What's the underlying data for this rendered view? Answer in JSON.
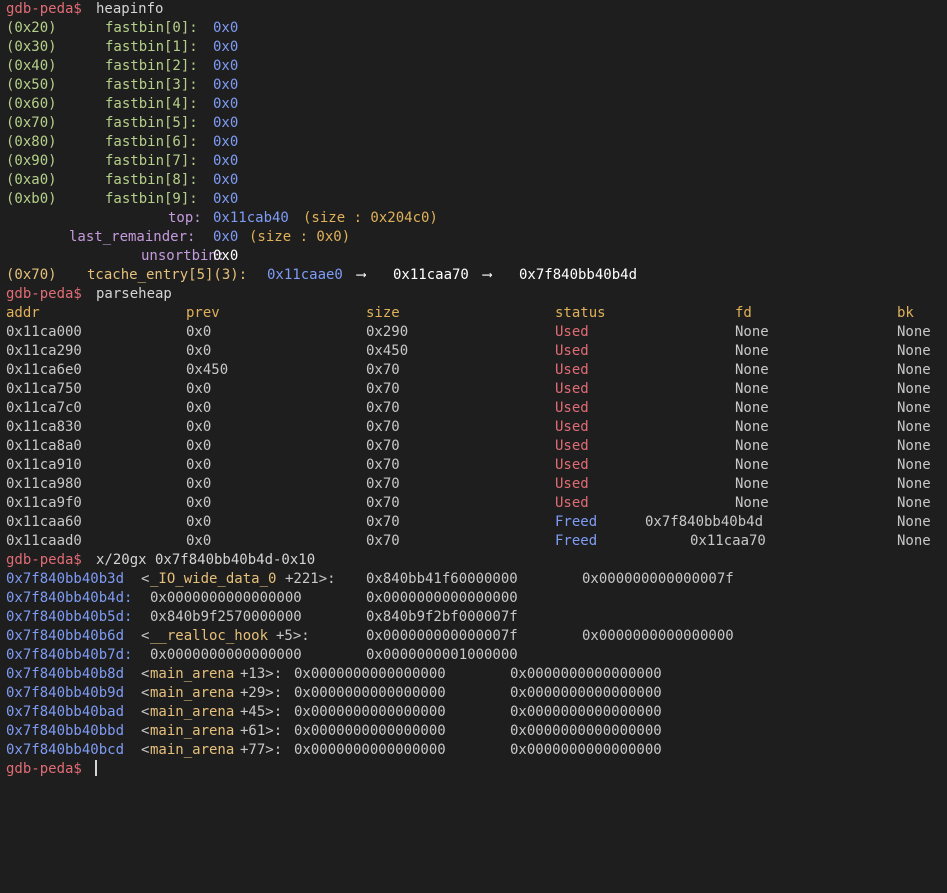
{
  "prompt": "gdb-peda$",
  "commands": {
    "heapinfo": "heapinfo",
    "parseheap": "parseheap",
    "examine": "x/20gx 0x7f840bb40b4d-0x10"
  },
  "heapinfo": {
    "fastbins": [
      {
        "size": "(0x20)",
        "name": "fastbin[0]:",
        "value": "0x0"
      },
      {
        "size": "(0x30)",
        "name": "fastbin[1]:",
        "value": "0x0"
      },
      {
        "size": "(0x40)",
        "name": "fastbin[2]:",
        "value": "0x0"
      },
      {
        "size": "(0x50)",
        "name": "fastbin[3]:",
        "value": "0x0"
      },
      {
        "size": "(0x60)",
        "name": "fastbin[4]:",
        "value": "0x0"
      },
      {
        "size": "(0x70)",
        "name": "fastbin[5]:",
        "value": "0x0"
      },
      {
        "size": "(0x80)",
        "name": "fastbin[6]:",
        "value": "0x0"
      },
      {
        "size": "(0x90)",
        "name": "fastbin[7]:",
        "value": "0x0"
      },
      {
        "size": "(0xa0)",
        "name": "fastbin[8]:",
        "value": "0x0"
      },
      {
        "size": "(0xb0)",
        "name": "fastbin[9]:",
        "value": "0x0"
      }
    ],
    "top": {
      "label": "top:",
      "addr": "0x11cab40",
      "size": "(size : 0x204c0)"
    },
    "last_remainder": {
      "label": "last_remainder:",
      "addr": "0x0",
      "size": "(size : 0x0)"
    },
    "unsortbin": {
      "label": "unsortbin:",
      "value": "0x0"
    },
    "tcache": {
      "size": "(0x70)",
      "label": "tcache_entry[5](3):",
      "first": "0x11caae0",
      "arrow1": "⟶",
      "second": "0x11caa70",
      "arrow2": "⟶",
      "third": "0x7f840bb40b4d"
    }
  },
  "parseheap": {
    "headers": [
      "addr",
      "prev",
      "size",
      "status",
      "fd",
      "bk"
    ],
    "rows": [
      {
        "addr": "0x11ca000",
        "prev": "0x0",
        "size": "0x290",
        "status": "Used",
        "fd": "None",
        "bk": "None"
      },
      {
        "addr": "0x11ca290",
        "prev": "0x0",
        "size": "0x450",
        "status": "Used",
        "fd": "None",
        "bk": "None"
      },
      {
        "addr": "0x11ca6e0",
        "prev": "0x450",
        "size": "0x70",
        "status": "Used",
        "fd": "None",
        "bk": "None"
      },
      {
        "addr": "0x11ca750",
        "prev": "0x0",
        "size": "0x70",
        "status": "Used",
        "fd": "None",
        "bk": "None"
      },
      {
        "addr": "0x11ca7c0",
        "prev": "0x0",
        "size": "0x70",
        "status": "Used",
        "fd": "None",
        "bk": "None"
      },
      {
        "addr": "0x11ca830",
        "prev": "0x0",
        "size": "0x70",
        "status": "Used",
        "fd": "None",
        "bk": "None"
      },
      {
        "addr": "0x11ca8a0",
        "prev": "0x0",
        "size": "0x70",
        "status": "Used",
        "fd": "None",
        "bk": "None"
      },
      {
        "addr": "0x11ca910",
        "prev": "0x0",
        "size": "0x70",
        "status": "Used",
        "fd": "None",
        "bk": "None"
      },
      {
        "addr": "0x11ca980",
        "prev": "0x0",
        "size": "0x70",
        "status": "Used",
        "fd": "None",
        "bk": "None"
      },
      {
        "addr": "0x11ca9f0",
        "prev": "0x0",
        "size": "0x70",
        "status": "Used",
        "fd": "None",
        "bk": "None"
      },
      {
        "addr": "0x11caa60",
        "prev": "0x0",
        "size": "0x70",
        "status": "Freed",
        "fd": "0x7f840bb40b4d",
        "bk": "None"
      },
      {
        "addr": "0x11caad0",
        "prev": "0x0",
        "size": "0x70",
        "status": "Freed",
        "fd": "0x11caa70",
        "bk": "None"
      }
    ]
  },
  "memory": [
    {
      "addr": "0x7f840bb40b3d",
      "sym": "_IO_wide_data_0",
      "sep": "<",
      "offset": "+221>:",
      "v1": "0x840bb41f60000000",
      "v2": "0x000000000000007f"
    },
    {
      "addr": "0x7f840bb40b4d:",
      "sym": "",
      "sep": "",
      "offset": "",
      "v1": "0x0000000000000000",
      "v2": "0x0000000000000000"
    },
    {
      "addr": "0x7f840bb40b5d:",
      "sym": "",
      "sep": "",
      "offset": "",
      "v1": "0x840b9f2570000000",
      "v2": "0x840b9f2bf000007f"
    },
    {
      "addr": "0x7f840bb40b6d",
      "sym": "__realloc_hook",
      "sep": "<",
      "offset": "+5>:",
      "v1": "0x000000000000007f",
      "v2": "0x0000000000000000"
    },
    {
      "addr": "0x7f840bb40b7d:",
      "sym": "",
      "sep": "",
      "offset": "",
      "v1": "0x0000000000000000",
      "v2": "0x0000000001000000"
    },
    {
      "addr": "0x7f840bb40b8d",
      "sym": "main_arena",
      "sep": "<",
      "offset": "+13>:",
      "v1": "0x0000000000000000",
      "v2": "0x0000000000000000"
    },
    {
      "addr": "0x7f840bb40b9d",
      "sym": "main_arena",
      "sep": "<",
      "offset": "+29>:",
      "v1": "0x0000000000000000",
      "v2": "0x0000000000000000"
    },
    {
      "addr": "0x7f840bb40bad",
      "sym": "main_arena",
      "sep": "<",
      "offset": "+45>:",
      "v1": "0x0000000000000000",
      "v2": "0x0000000000000000"
    },
    {
      "addr": "0x7f840bb40bbd",
      "sym": "main_arena",
      "sep": "<",
      "offset": "+61>:",
      "v1": "0x0000000000000000",
      "v2": "0x0000000000000000"
    },
    {
      "addr": "0x7f840bb40bcd",
      "sym": "main_arena",
      "sep": "<",
      "offset": "+77>:",
      "v1": "0x0000000000000000",
      "v2": "0x0000000000000000"
    }
  ],
  "colors": {
    "background": "#1e1e1e",
    "prompt": "#e06c75",
    "bin_size": "#b5d08a",
    "address": "#7f9cf5",
    "label": "#c49bdc",
    "status_used": "#e06c75",
    "status_freed": "#7f9cf5",
    "header": "#e0b15a",
    "symbol": "#e5c07b"
  }
}
